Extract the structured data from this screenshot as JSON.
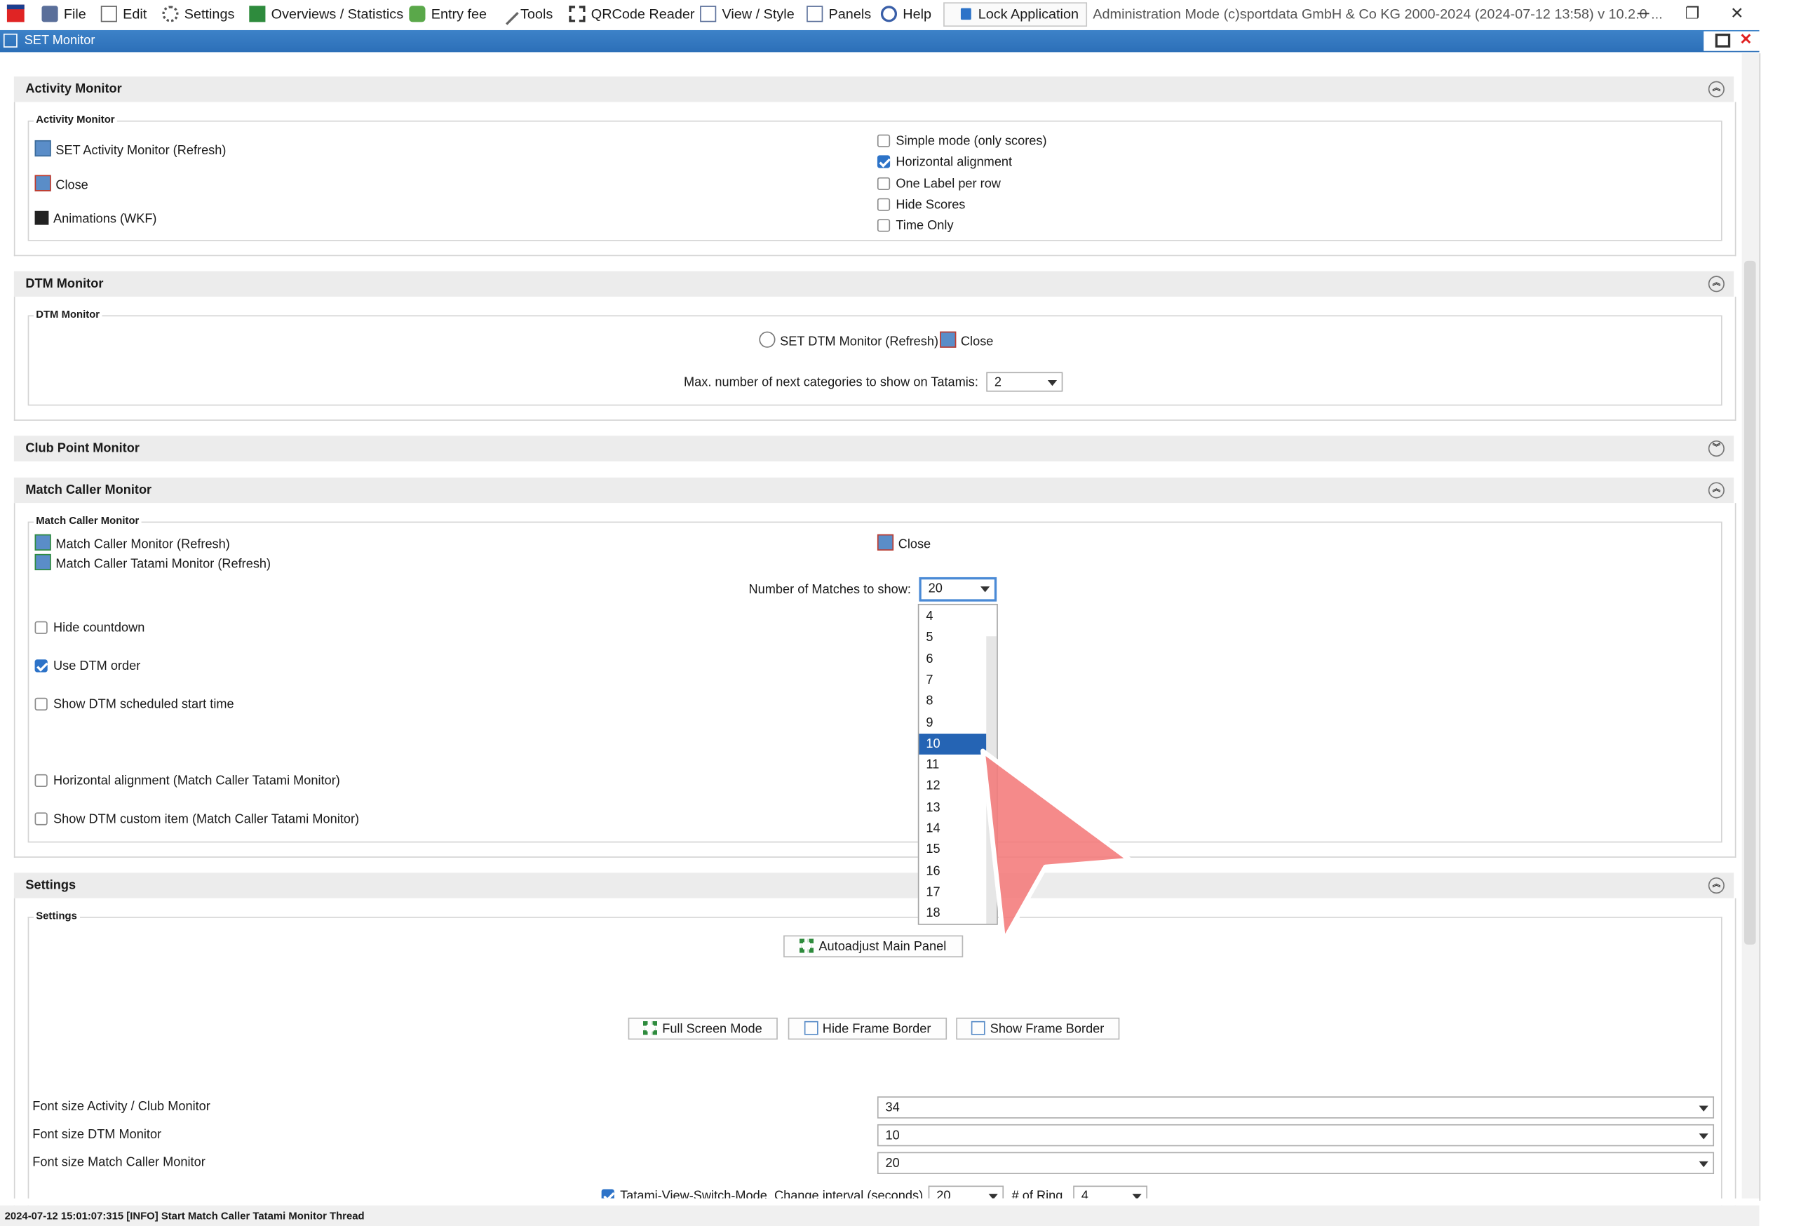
{
  "menubar": {
    "items": [
      {
        "label": "File",
        "icon": "file-icon"
      },
      {
        "label": "Edit",
        "icon": "edit-icon"
      },
      {
        "label": "Settings",
        "icon": "gear-icon"
      },
      {
        "label": "Overviews / Statistics",
        "icon": "statistics-icon"
      },
      {
        "label": "Entry fee",
        "icon": "money-icon"
      },
      {
        "label": "Tools",
        "icon": "wrench-icon"
      },
      {
        "label": "QRCode Reader",
        "icon": "qrcode-icon"
      },
      {
        "label": "View / Style",
        "icon": "view-icon"
      },
      {
        "label": "Panels",
        "icon": "panels-icon"
      },
      {
        "label": "Help",
        "icon": "help-icon"
      }
    ],
    "lock_label": "Lock Application",
    "admin_text": "Administration Mode (c)sportdata GmbH & Co KG 2000-2024 (2024-07-12 13:58)  v 10.2.0 ..."
  },
  "window": {
    "title": "SET Monitor"
  },
  "activity": {
    "header": "Activity Monitor",
    "legend": "Activity Monitor",
    "actions": [
      "SET Activity Monitor (Refresh)",
      "Close",
      "Animations (WKF)"
    ],
    "options": [
      {
        "label": "Simple mode (only scores)",
        "checked": false
      },
      {
        "label": "Horizontal alignment",
        "checked": true
      },
      {
        "label": "One Label per row",
        "checked": false
      },
      {
        "label": "Hide Scores",
        "checked": false
      },
      {
        "label": "Time Only",
        "checked": false
      }
    ]
  },
  "dtm": {
    "header": "DTM Monitor",
    "legend": "DTM Monitor",
    "refresh": "SET DTM Monitor (Refresh)",
    "close": "Close",
    "max_label": "Max. number of next categories to show on Tatamis:",
    "max_value": "2"
  },
  "club": {
    "header": "Club Point Monitor"
  },
  "matchcaller": {
    "header": "Match Caller Monitor",
    "legend": "Match Caller Monitor",
    "refresh": "Match Caller Monitor (Refresh)",
    "tatami_refresh": "Match Caller Tatami Monitor (Refresh)",
    "close": "Close",
    "num_label": "Number of Matches to show:",
    "num_value": "20",
    "options": [
      {
        "label": "Hide countdown",
        "checked": false
      },
      {
        "label": "Use DTM order",
        "checked": true
      },
      {
        "label": "Show DTM scheduled start time",
        "checked": false
      },
      {
        "label": "Horizontal alignment (Match Caller Tatami Monitor)",
        "checked": false
      },
      {
        "label": "Show DTM custom item (Match Caller Tatami Monitor)",
        "checked": false
      }
    ],
    "dropdown": {
      "options": [
        "4",
        "5",
        "6",
        "7",
        "8",
        "9",
        "10",
        "11",
        "12",
        "13",
        "14",
        "15",
        "16",
        "17",
        "18"
      ],
      "highlighted": "10"
    }
  },
  "settings": {
    "header": "Settings",
    "legend": "Settings",
    "autoadjust": "Autoadjust Main Panel",
    "fullscreen": "Full Screen Mode",
    "hide_border": "Hide Frame Border",
    "show_border": "Show Frame Border",
    "fonts": [
      {
        "label": "Font size Activity / Club Monitor",
        "value": "34"
      },
      {
        "label": "Font size DTM Monitor",
        "value": "10"
      },
      {
        "label": "Font size Match Caller Monitor",
        "value": "20"
      }
    ],
    "tatami_switch_label": "Tatami-View-Switch-Mode, Change interval (seconds)",
    "tatami_switch_value": "20",
    "ring_label": "# of Ring",
    "ring_value": "4"
  },
  "status": "2024-07-12 15:01:07:315 [INFO] Start Match Caller Tatami Monitor Thread",
  "colors": {
    "accent": "#2d73c8",
    "selection": "#2564b4",
    "titlebar": "#3577c2",
    "cursor": "#f47a7a"
  }
}
